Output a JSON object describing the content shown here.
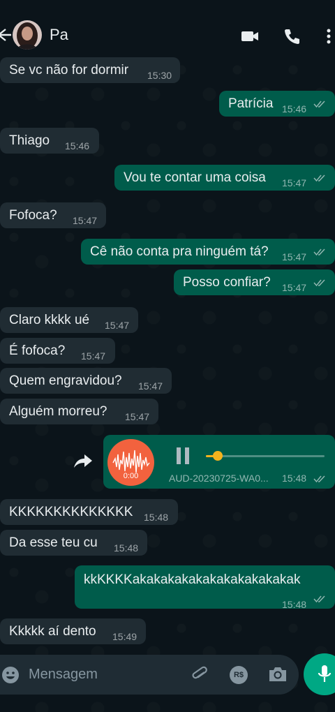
{
  "header": {
    "contact_name": "Pa"
  },
  "messages": [
    {
      "dir": "in",
      "text": "Se vc não for dormir",
      "time": "15:30"
    },
    {
      "dir": "out",
      "text": "Patrícia",
      "time": "15:46"
    },
    {
      "dir": "in",
      "text": "Thiago",
      "time": "15:46"
    },
    {
      "dir": "out",
      "text": "Vou te contar uma coisa",
      "time": "15:47"
    },
    {
      "dir": "in",
      "text": "Fofoca?",
      "time": "15:47"
    },
    {
      "dir": "out",
      "text": "Cê não conta pra ninguém tá?",
      "time": "15:47"
    },
    {
      "dir": "out",
      "text": "Posso confiar?",
      "time": "15:47"
    },
    {
      "dir": "in",
      "text": "Claro kkkk ué",
      "time": "15:47"
    },
    {
      "dir": "in",
      "text": "É fofoca?",
      "time": "15:47"
    },
    {
      "dir": "in",
      "text": "Quem engravidou?",
      "time": "15:47"
    },
    {
      "dir": "in",
      "text": "Alguém morreu?",
      "time": "15:47"
    },
    {
      "dir": "in",
      "text": "KKKKKKKKKKKKKK",
      "time": "15:48"
    },
    {
      "dir": "in",
      "text": "Da esse teu cu",
      "time": "15:48"
    },
    {
      "dir": "out",
      "text": "kkKKKKakakakakakakakakakakakak",
      "time": "15:48"
    },
    {
      "dir": "in",
      "text": "Kkkkk aí dento",
      "time": "15:49"
    }
  ],
  "audio": {
    "thumb_time": "0:00",
    "filename": "AUD-20230725-WA0...",
    "time": "15:48",
    "progress": 0.1,
    "colors": {
      "thumb": "#f2623e",
      "progress": "#f5b31d"
    }
  },
  "input": {
    "placeholder": "Mensagem",
    "pay_label": "R$"
  },
  "colors": {
    "background": "#0b141a",
    "incoming": "#202c33",
    "outgoing": "#005c4b",
    "accent": "#00a884"
  },
  "icons": [
    "back-arrow-icon",
    "video-call-icon",
    "phone-icon",
    "more-icon",
    "read-ticks-icon",
    "forward-icon",
    "pause-icon",
    "emoji-icon",
    "attach-icon",
    "camera-icon",
    "mic-icon"
  ]
}
